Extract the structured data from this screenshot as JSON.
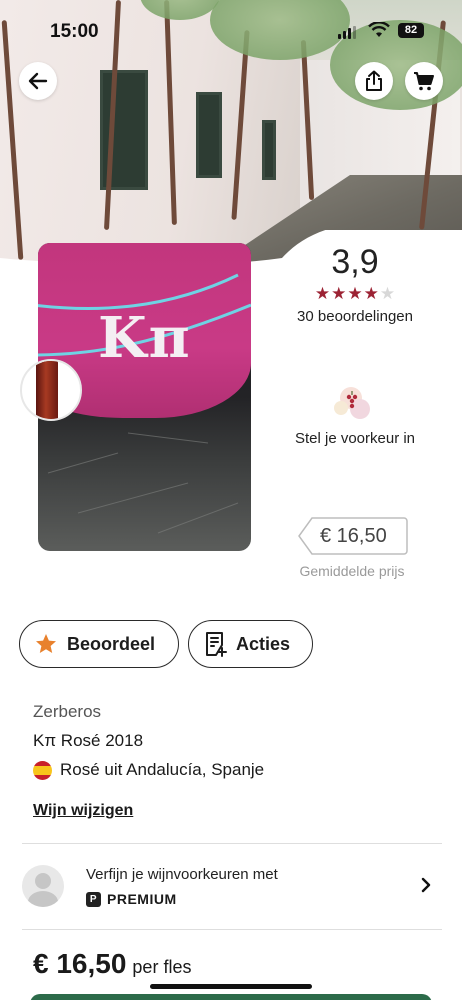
{
  "status_bar": {
    "time": "15:00",
    "battery": "82"
  },
  "colors": {
    "star_filled": "#9c2334",
    "star_empty": "#d8d8d8",
    "brand_green": "#2c6b4a",
    "label_pink": "#c2367d"
  },
  "hero": {
    "icons": [
      "back-arrow-icon",
      "share-icon",
      "cart-icon"
    ]
  },
  "product": {
    "label_text": "Kπ"
  },
  "rating": {
    "score": "3,9",
    "stars_value": 3.9,
    "stars_total": 5,
    "count_text": "30 beoordelingen"
  },
  "taste_profile": {
    "text": "Stel je voorkeur in"
  },
  "price_tag": {
    "value": "€ 16,50",
    "caption": "Gemiddelde prijs"
  },
  "actions": {
    "rate_label": "Beoordeel",
    "actions_label": "Acties"
  },
  "wine": {
    "producer": "Zerberos",
    "name": "Kπ Rosé 2018",
    "region": "Rosé uit Andalucía, Spanje",
    "edit_link": "Wijn wijzigen"
  },
  "premium": {
    "text": "Verfijn je wijnvoorkeuren met",
    "badge": "PREMIUM"
  },
  "footer": {
    "price": "€ 16,50",
    "unit": "per fles"
  }
}
